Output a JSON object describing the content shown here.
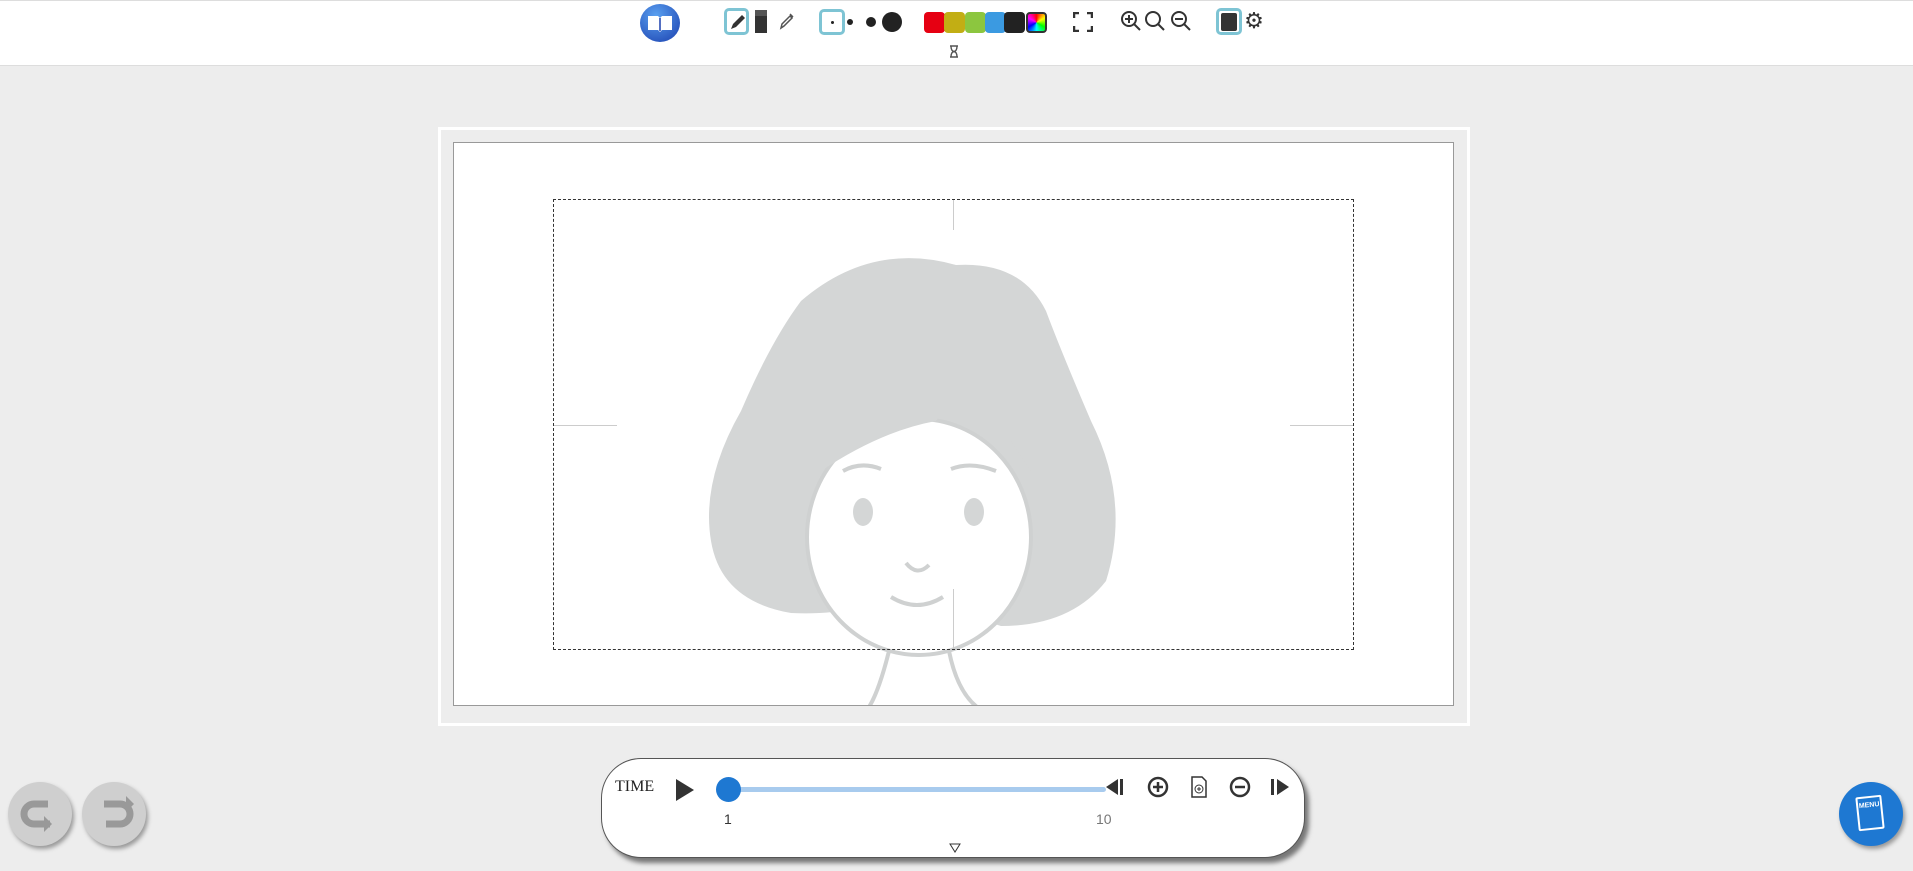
{
  "toolbar": {
    "icons": [
      "book-logo-icon",
      "pen-icon",
      "eraser-icon",
      "dropper-icon",
      "size-small-icon",
      "size-dot-1",
      "size-dot-2",
      "size-dot-3",
      "fullscreen-icon",
      "zoom-in-icon",
      "zoom-reset-icon",
      "zoom-out-icon",
      "background-image-icon",
      "gear-icon",
      "hourglass-icon"
    ],
    "colors": [
      "#e60012",
      "#c2ae14",
      "#8cc63f",
      "#3b9ae1",
      "#222222"
    ],
    "selected_tool": "pen",
    "selected_size": "small",
    "selection_color": "#7ec4d4"
  },
  "timeline": {
    "label": "TIME",
    "min_label": "1",
    "max_label": "10",
    "current_frame": 1,
    "accent": "#1e78d2"
  },
  "buttons": {
    "undo": "undo-icon",
    "redo": "redo-icon",
    "menu": "MENU"
  }
}
